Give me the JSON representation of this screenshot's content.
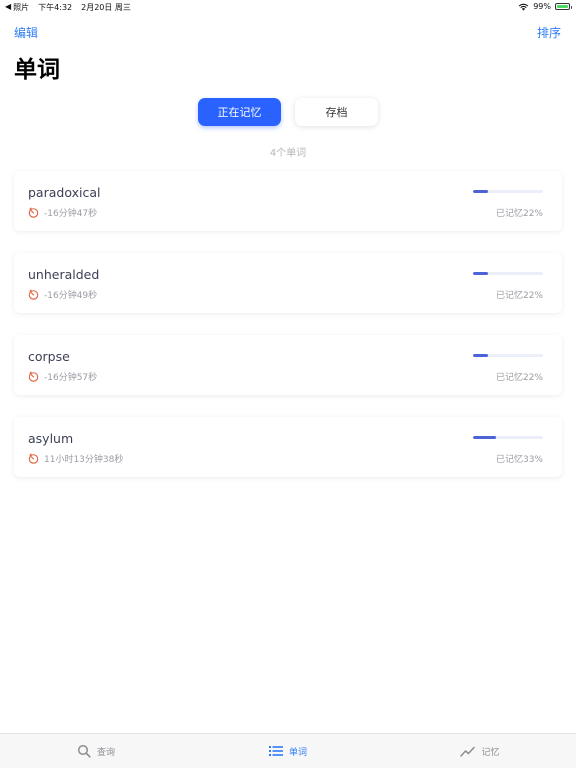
{
  "status_bar": {
    "back_arrow": "◀",
    "back_app": "照片",
    "time": "下午4:32",
    "date": "2月20日 周三",
    "battery_text": "99%",
    "battery_level": 0.99,
    "battery_color": "#4cd964"
  },
  "nav": {
    "edit_label": "编辑",
    "sort_label": "排序",
    "title": "单词"
  },
  "segments": {
    "active_label": "正在记忆",
    "inactive_label": "存档"
  },
  "word_count": "4个单词",
  "words": [
    {
      "word": "paradoxical",
      "timer": "-16分钟47秒",
      "progress_text": "已记忆22%",
      "progress": 0.22
    },
    {
      "word": "unheralded",
      "timer": "-16分钟49秒",
      "progress_text": "已记忆22%",
      "progress": 0.22
    },
    {
      "word": "corpse",
      "timer": "-16分钟57秒",
      "progress_text": "已记忆22%",
      "progress": 0.22
    },
    {
      "word": "asylum",
      "timer": "11小时13分钟38秒",
      "progress_text": "已记忆33%",
      "progress": 0.33
    }
  ],
  "tabs": [
    {
      "label": "查询",
      "icon": "search-icon",
      "active": false
    },
    {
      "label": "单词",
      "icon": "list-icon",
      "active": true
    },
    {
      "label": "记忆",
      "icon": "trend-icon",
      "active": false
    }
  ],
  "colors": {
    "accent": "#2f7cf6",
    "segment_active": "#2962ff",
    "progress": "#4d62d6",
    "timer_icon": "#e0613f"
  }
}
